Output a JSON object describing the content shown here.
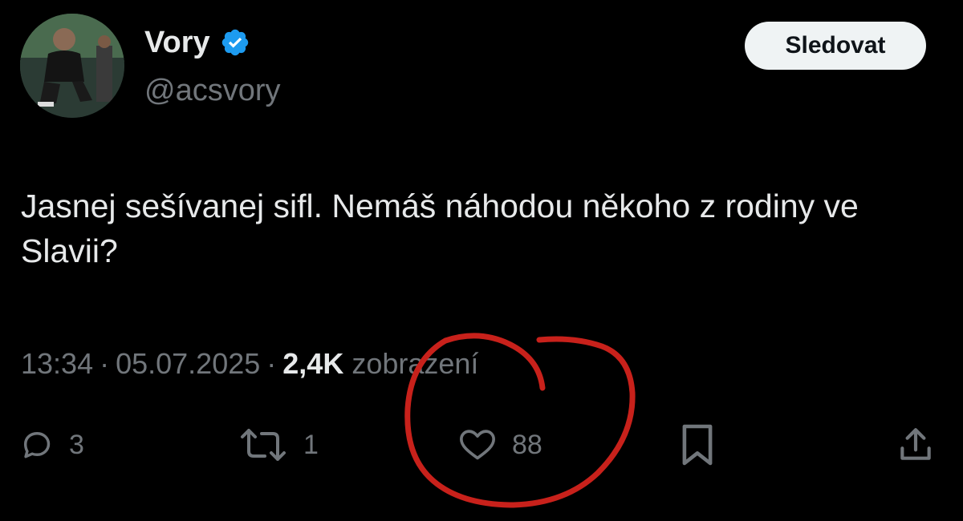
{
  "user": {
    "display_name": "Vory",
    "handle": "@acsvory",
    "verified": true,
    "verified_color": "#1d9bf0"
  },
  "follow_button": {
    "label": "Sledovat"
  },
  "tweet": {
    "text": "Jasnej sešívanej sifl. Nemáš náhodou někoho z rodiny ve Slavii?",
    "time": "13:34",
    "date": "05.07.2025",
    "views_count": "2,4K",
    "views_label": "zobrazení"
  },
  "actions": {
    "reply_count": "3",
    "retweet_count": "1",
    "like_count": "88"
  },
  "colors": {
    "background": "#000000",
    "text_primary": "#e7e9ea",
    "text_secondary": "#71767b",
    "annotation": "#c8211b"
  },
  "icons": [
    "verified-badge-icon",
    "reply-icon",
    "retweet-icon",
    "like-heart-icon",
    "bookmark-icon",
    "share-icon"
  ]
}
